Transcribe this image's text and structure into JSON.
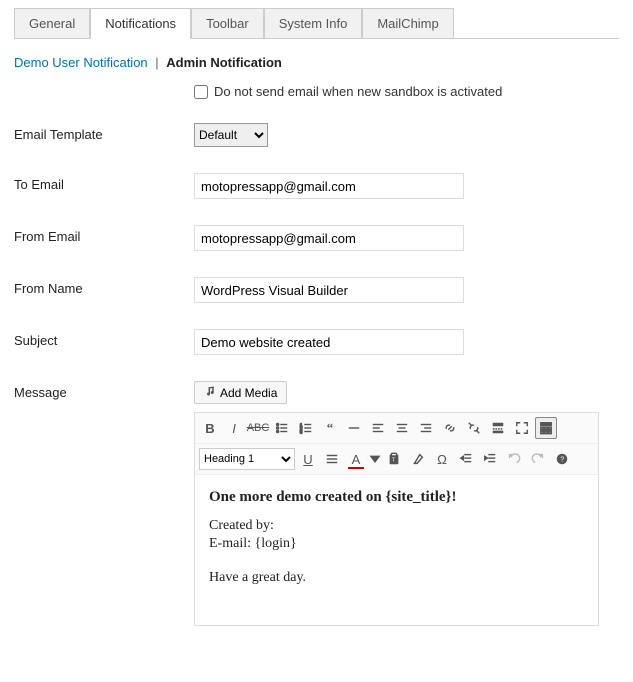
{
  "tabs": [
    "General",
    "Notifications",
    "Toolbar",
    "System Info",
    "MailChimp"
  ],
  "active_tab_index": 1,
  "subnav": {
    "link": "Demo User Notification",
    "sep": "|",
    "current": "Admin Notification"
  },
  "checkbox_label": "Do not send email when new sandbox is activated",
  "labels": {
    "template": "Email Template",
    "to_email": "To Email",
    "from_email": "From Email",
    "from_name": "From Name",
    "subject": "Subject",
    "message": "Message"
  },
  "fields": {
    "template_select": "Default",
    "to_email": "motopressapp@gmail.com",
    "from_email": "motopressapp@gmail.com",
    "from_name": "WordPress Visual Builder",
    "subject": "Demo website created"
  },
  "media_button": "Add Media",
  "format_select": "Heading 1",
  "message_body": {
    "heading": "One more demo created on {site_title}!",
    "line1": "Created by:",
    "line2": "E-mail: {login}",
    "line3": "Have a great day."
  }
}
